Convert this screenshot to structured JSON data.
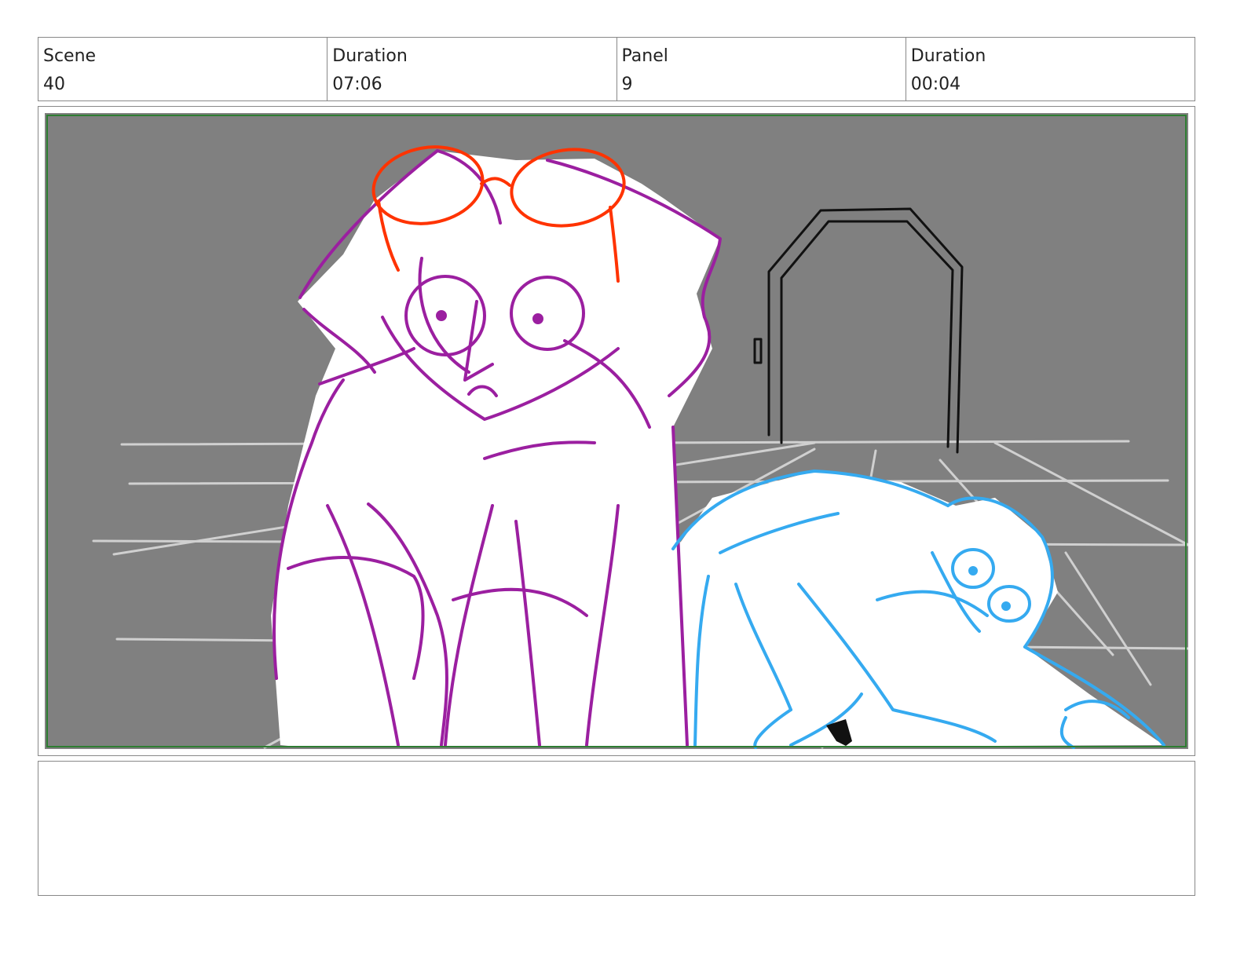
{
  "header": {
    "scene_label": "Scene",
    "scene_value": "40",
    "scene_duration_label": "Duration",
    "scene_duration_value": "07:06",
    "panel_label": "Panel",
    "panel_value": "9",
    "panel_duration_label": "Duration",
    "panel_duration_value": "00:04"
  },
  "panel": {
    "background_color": "#808080",
    "safe_frame_color": "#2e7d32",
    "floor_line_color": "#d0d0d0",
    "door_color": "#111111",
    "character_left_color": "#9b1fa0",
    "glasses_color": "#ff3300",
    "character_right_color": "#35aaf0"
  },
  "notes": {
    "text": ""
  }
}
